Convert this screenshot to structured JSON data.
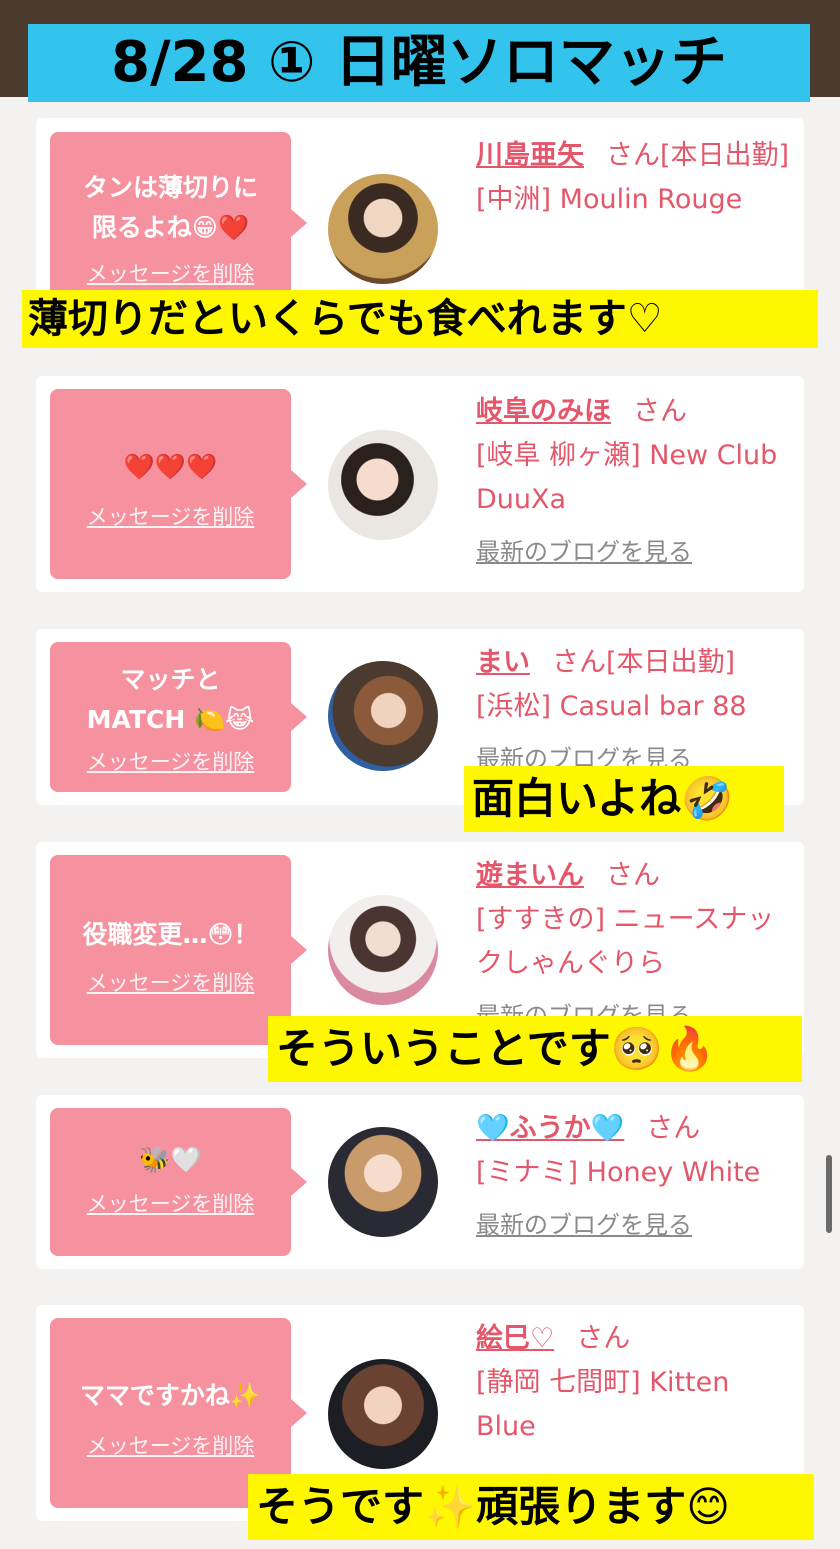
{
  "title": "8/28 ① 日曜ソロマッチ",
  "delete_label": "メッセージを削除",
  "blog_label": "最新のブログを見る",
  "cards": [
    {
      "message": "タンは薄切りに限るよね😁❤️",
      "name": "川島亜矢",
      "san": "さん[本日出勤]",
      "shop": "[中洲] Moulin Rouge"
    },
    {
      "message": "❤️❤️❤️",
      "name": "岐阜のみほ",
      "san": "さん",
      "shop": "[岐阜 柳ヶ瀬] New Club DuuXa"
    },
    {
      "message": "マッチとMATCH 🍋😹",
      "name": "まい",
      "san": "さん[本日出勤]",
      "shop": "[浜松] Casual bar 88"
    },
    {
      "message": "役職変更…😳！",
      "name": "遊まいん",
      "san": "さん",
      "shop": "[すすきの] ニュースナックしゃんぐりら"
    },
    {
      "message": "🐝🤍",
      "name": "🩵ふうか🩵",
      "san": "さん",
      "shop": "[ミナミ] Honey White"
    },
    {
      "message": "ママですかね✨",
      "name": "絵巳♡",
      "san": "さん",
      "shop": "[静岡 七間町] Kitten Blue"
    }
  ],
  "captions": [
    "薄切りだといくらでも食べれます♡",
    "面白いよね🤣",
    "そういうことです🥺🔥",
    "そうです✨頑張ります😊"
  ],
  "colors": {
    "banner": "#33c4ee",
    "bubble": "#f6919f",
    "accent": "#e4576a",
    "caption": "#fff700"
  }
}
